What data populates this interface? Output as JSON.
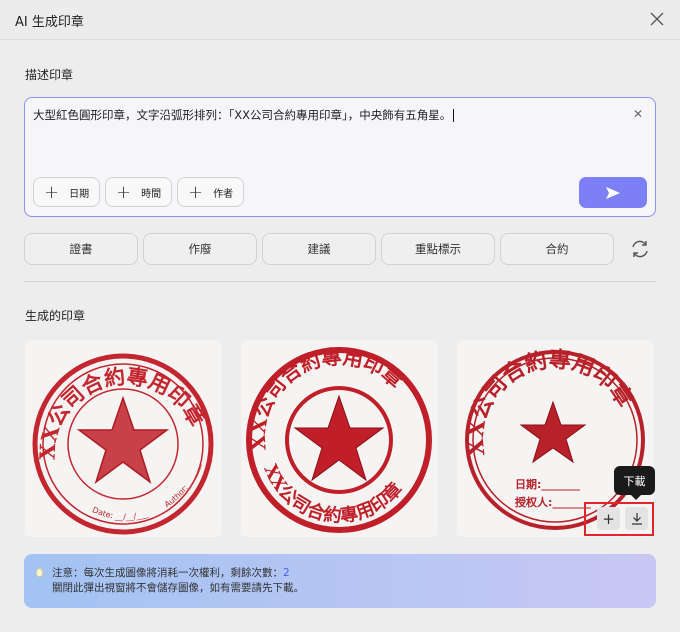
{
  "header": {
    "title": "AI 生成印章",
    "close_icon": "close-icon"
  },
  "describe": {
    "label": "描述印章",
    "value": "大型紅色圓形印章，文字沿弧形排列：「XX公司合約專用印章」，中央飾有五角星。",
    "chips": [
      "日期",
      "時間",
      "作者"
    ]
  },
  "tags": [
    "證書",
    "作廢",
    "建議",
    "重點標示",
    "合約"
  ],
  "results": {
    "label": "生成的印章",
    "stamp_text": "XX公司合約專用印章",
    "stamp1_bottom": {
      "date": "Date: __/__/___",
      "author": "Author: ______"
    },
    "stamp3_lines": [
      "日期:_______",
      "授权人:_______"
    ],
    "tooltip": "下載"
  },
  "notice": {
    "line1": "注意：每次生成圖像將消耗一次權利，剩餘次數：",
    "count": "2",
    "line2": "關閉此彈出視窗將不會儲存圖像，如有需要請先下載。"
  },
  "colors": {
    "accent": "#7c80f4",
    "stamp_red": "#c0202a",
    "highlight": "#e0252b"
  }
}
